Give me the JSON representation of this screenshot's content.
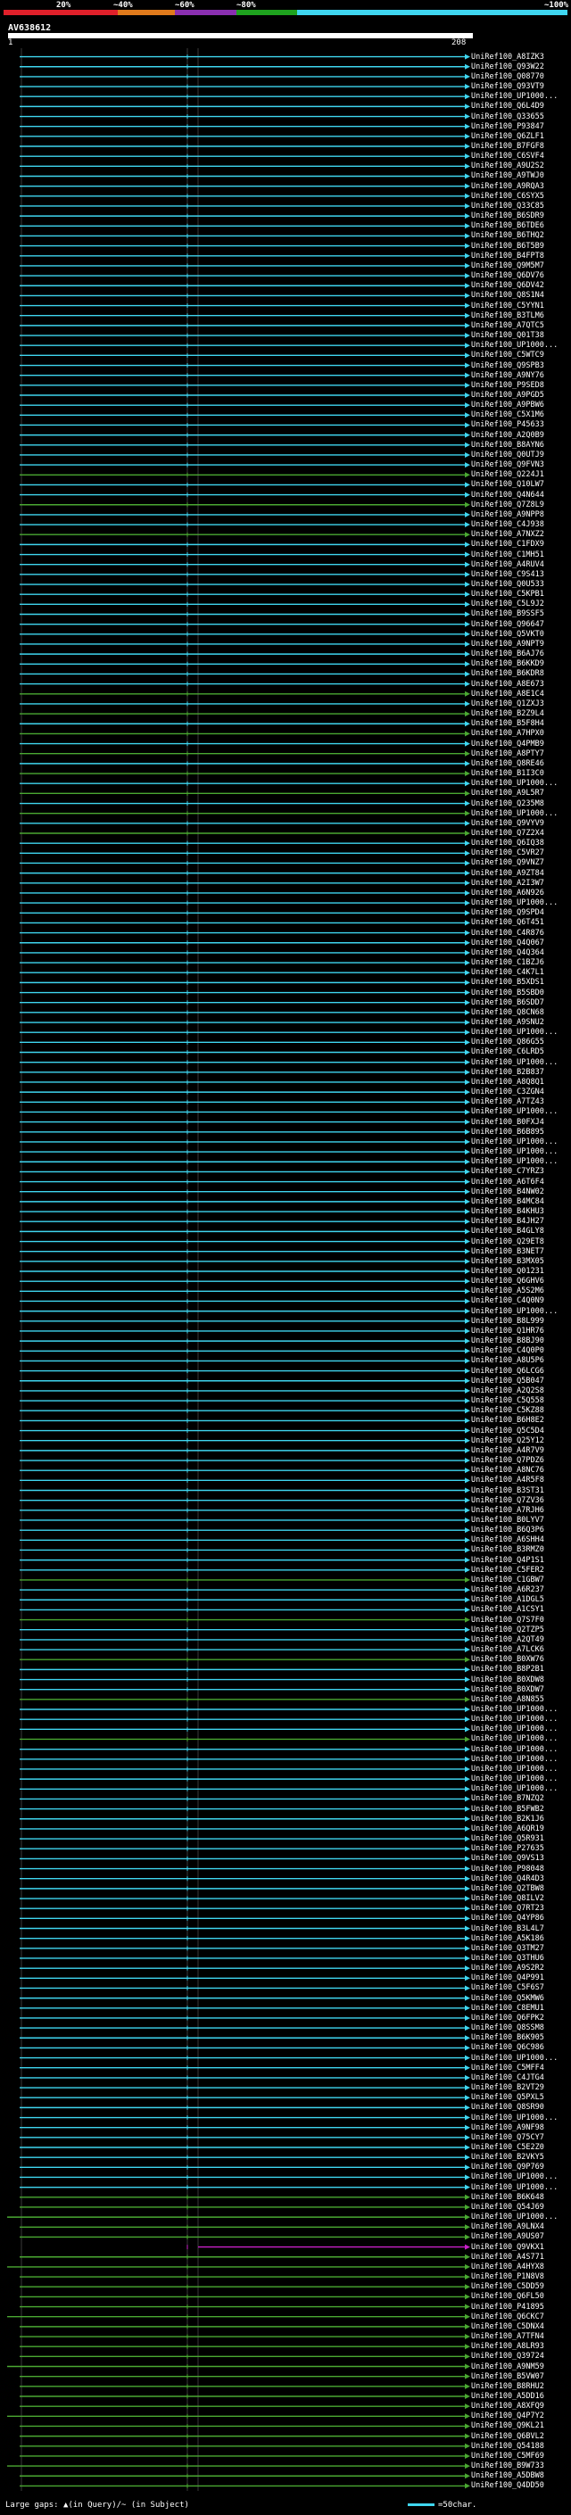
{
  "legend": {
    "scale": [
      "20%",
      "~40%",
      "~60%",
      "~80%",
      "~100%"
    ],
    "scale_colors": [
      "#e0202a",
      "#e07a1c",
      "#8a2fb0",
      "#1ea21e",
      "#3fd6f0"
    ]
  },
  "query": {
    "name": "AV638612",
    "start_tick": "1",
    "end_tick": "208"
  },
  "colors": {
    "blue": "#3fd6f0",
    "green": "#4aa832",
    "magenta": "#c91fc9",
    "gray_line": "#3a3a3a"
  },
  "hit_labels": [
    "UniRef100_A8IZK3",
    "UniRef100_Q93W22",
    "UniRef100_Q08770",
    "UniRef100_Q93VT9",
    "UniRef100_UP1000...",
    "UniRef100_Q6L4D9",
    "UniRef100_Q33655",
    "UniRef100_P93847",
    "UniRef100_Q6ZLF1",
    "UniRef100_B7FGF8",
    "UniRef100_C6SVF4",
    "UniRef100_A9U2S2",
    "UniRef100_A9TWJ0",
    "UniRef100_A9RQA3",
    "UniRef100_C6SYX5",
    "UniRef100_Q33C85",
    "UniRef100_B6SDR9",
    "UniRef100_B6TDE6",
    "UniRef100_B6THQ2",
    "UniRef100_B6T5B9",
    "UniRef100_B4FPT8",
    "UniRef100_Q9M5M7",
    "UniRef100_Q6DV76",
    "UniRef100_Q6DV42",
    "UniRef100_Q8S1N4",
    "UniRef100_C5YYN1",
    "UniRef100_B3TLM6",
    "UniRef100_A7QTC5",
    "UniRef100_Q01T38",
    "UniRef100_UP1000...",
    "UniRef100_C5WTC9",
    "UniRef100_Q9SPB3",
    "UniRef100_A9NY76",
    "UniRef100_P9SED8",
    "UniRef100_A9PGD5",
    "UniRef100_A9PBW6",
    "UniRef100_C5X1M6",
    "UniRef100_P45633",
    "UniRef100_A2Q0B9",
    "UniRef100_B8AYN6",
    "UniRef100_Q0UTJ9",
    "UniRef100_Q9FVN3",
    "UniRef100_Q224J1",
    "UniRef100_Q10LW7",
    "UniRef100_Q4N644",
    "UniRef100_Q7Z8L9",
    "UniRef100_A9NPP8",
    "UniRef100_C4J938",
    "UniRef100_A7NXZ2",
    "UniRef100_C1FDX9",
    "UniRef100_C1MH51",
    "UniRef100_A4RUV4",
    "UniRef100_C9S413",
    "UniRef100_Q0U533",
    "UniRef100_C5KPB1",
    "UniRef100_C5L9J2",
    "UniRef100_B9SSF5",
    "UniRef100_Q96647",
    "UniRef100_Q5VKT0",
    "UniRef100_A9NPT9",
    "UniRef100_B6AJ76",
    "UniRef100_B6KKD9",
    "UniRef100_B6KDR8",
    "UniRef100_A8E673",
    "UniRef100_A8E1C4",
    "UniRef100_Q1ZXJ3",
    "UniRef100_B2Z9L4",
    "UniRef100_B5F8H4",
    "UniRef100_A7HPX0",
    "UniRef100_Q4PMB9",
    "UniRef100_A8PTY7",
    "UniRef100_Q8RE46",
    "UniRef100_B1I3C0",
    "UniRef100_UP1000...",
    "UniRef100_A9L5R7",
    "UniRef100_Q235M8",
    "UniRef100_UP1000...",
    "UniRef100_Q9VYV9",
    "UniRef100_Q7Z2X4",
    "UniRef100_Q6IQ38",
    "UniRef100_C5VR27",
    "UniRef100_Q9VNZ7",
    "UniRef100_A9ZT84",
    "UniRef100_A2I3W7",
    "UniRef100_A6N926",
    "UniRef100_UP1000...",
    "UniRef100_Q9SPD4",
    "UniRef100_Q6T451",
    "UniRef100_C4R876",
    "UniRef100_Q4Q067",
    "UniRef100_Q4Q364",
    "UniRef100_C1BZJ6",
    "UniRef100_C4K7L1",
    "UniRef100_B5XDS1",
    "UniRef100_B5SBD0",
    "UniRef100_B6SDD7",
    "UniRef100_Q8CN68",
    "UniRef100_A9SNU2",
    "UniRef100_UP1000...",
    "UniRef100_Q86G55",
    "UniRef100_C6LRD5",
    "UniRef100_UP1000...",
    "UniRef100_B2B837",
    "UniRef100_A8Q8Q1",
    "UniRef100_C3ZGN4",
    "UniRef100_A7TZ43",
    "UniRef100_UP1000...",
    "UniRef100_B0FXJ4",
    "UniRef100_B6B895",
    "UniRef100_UP1000...",
    "UniRef100_UP1000...",
    "UniRef100_UP1000...",
    "UniRef100_C7YRZ3",
    "UniRef100_A6T6F4",
    "UniRef100_B4NW02",
    "UniRef100_B4MC84",
    "UniRef100_B4KHU3",
    "UniRef100_B4JH27",
    "UniRef100_B4GLY8",
    "UniRef100_Q29ET8",
    "UniRef100_B3NET7",
    "UniRef100_B3MX05",
    "UniRef100_Q01231",
    "UniRef100_Q6GHV6",
    "UniRef100_A5S2M6",
    "UniRef100_C4Q0N9",
    "UniRef100_UP1000...",
    "UniRef100_B8L999",
    "UniRef100_Q1HR76",
    "UniRef100_B8BJ90",
    "UniRef100_C4Q0P0",
    "UniRef100_A8U5P6",
    "UniRef100_Q6LCG6",
    "UniRef100_Q5B047",
    "UniRef100_A2Q2S8",
    "UniRef100_C5Q558",
    "UniRef100_C5KZ88",
    "UniRef100_B6H8E2",
    "UniRef100_Q5C5D4",
    "UniRef100_Q25Y12",
    "UniRef100_A4R7V9",
    "UniRef100_Q7PDZ6",
    "UniRef100_A8NC76",
    "UniRef100_A4R5F8",
    "UniRef100_B3ST31",
    "UniRef100_Q7ZV36",
    "UniRef100_A7RJH6",
    "UniRef100_B0LYV7",
    "UniRef100_B6Q3P6",
    "UniRef100_A6SHH4",
    "UniRef100_B3RMZ0",
    "UniRef100_Q4P1S1",
    "UniRef100_C5FER2",
    "UniRef100_C1GBW7",
    "UniRef100_A6R237",
    "UniRef100_A1DGL5",
    "UniRef100_A1CSY1",
    "UniRef100_Q7S7F0",
    "UniRef100_Q2TZP5",
    "UniRef100_A2QT49",
    "UniRef100_A7LCK6",
    "UniRef100_B0XW76",
    "UniRef100_B8P2B1",
    "UniRef100_B0XDW8",
    "UniRef100_B0XDW7",
    "UniRef100_A8N855",
    "UniRef100_UP1000...",
    "UniRef100_UP1000...",
    "UniRef100_UP1000...",
    "UniRef100_UP1000...",
    "UniRef100_UP1000...",
    "UniRef100_UP1000...",
    "UniRef100_UP1000...",
    "UniRef100_UP1000...",
    "UniRef100_UP1000...",
    "UniRef100_B7NZQ2",
    "UniRef100_B5FWB2",
    "UniRef100_B2K1J6",
    "UniRef100_A6QR19",
    "UniRef100_Q5R931",
    "UniRef100_P27635",
    "UniRef100_Q9VS13",
    "UniRef100_P98048",
    "UniRef100_Q4R4D3",
    "UniRef100_Q2TBW8",
    "UniRef100_Q8ILV2",
    "UniRef100_Q7RT23",
    "UniRef100_Q4YP86",
    "UniRef100_B3L4L7",
    "UniRef100_A5K186",
    "UniRef100_Q3TM27",
    "UniRef100_Q3THU6",
    "UniRef100_A9S2R2",
    "UniRef100_Q4P991",
    "UniRef100_C5F6S7",
    "UniRef100_Q5KMW6",
    "UniRef100_C8EMU1",
    "UniRef100_Q6FPK2",
    "UniRef100_Q8SSM8",
    "UniRef100_B6K905",
    "UniRef100_Q6C986",
    "UniRef100_UP1000...",
    "UniRef100_C5MFF4",
    "UniRef100_C4JTG4",
    "UniRef100_B2VT29",
    "UniRef100_Q5PXL5",
    "UniRef100_Q8SR90",
    "UniRef100_UP1000...",
    "UniRef100_A9NF98",
    "UniRef100_Q75CY7",
    "UniRef100_C5E2Z0",
    "UniRef100_B2VKY5",
    "UniRef100_Q9P769",
    "UniRef100_UP1000...",
    "UniRef100_UP1000...",
    "UniRef100_B6K648",
    "UniRef100_Q54J69",
    "UniRef100_UP1000...",
    "UniRef100_A9LNX4",
    "UniRef100_A9US07",
    "UniRef100_Q9VKX1",
    "UniRef100_A4S771",
    "UniRef100_A4HYX8",
    "UniRef100_P1N8V8",
    "UniRef100_C5DD59",
    "UniRef100_Q6FL50",
    "UniRef100_P41895",
    "UniRef100_Q6CKC7",
    "UniRef100_C5DNX4",
    "UniRef100_A7TFN4",
    "UniRef100_A8LR93",
    "UniRef100_Q39724",
    "UniRef100_A9NM59",
    "UniRef100_B5VW07",
    "UniRef100_B8RHU2",
    "UniRef100_A5DD16",
    "UniRef100_A8XFQ9",
    "UniRef100_Q4P7Y2",
    "UniRef100_Q9KL21",
    "UniRef100_Q6BVL2",
    "UniRef100_Q54188",
    "UniRef100_C5MF69",
    "UniRef100_B9W733",
    "UniRef100_A5DBW8",
    "UniRef100_Q4DD50"
  ],
  "footer": {
    "gaps_text": "Large gaps: ▲(in Query)/~ (in Subject)",
    "key_text": "=50char."
  }
}
